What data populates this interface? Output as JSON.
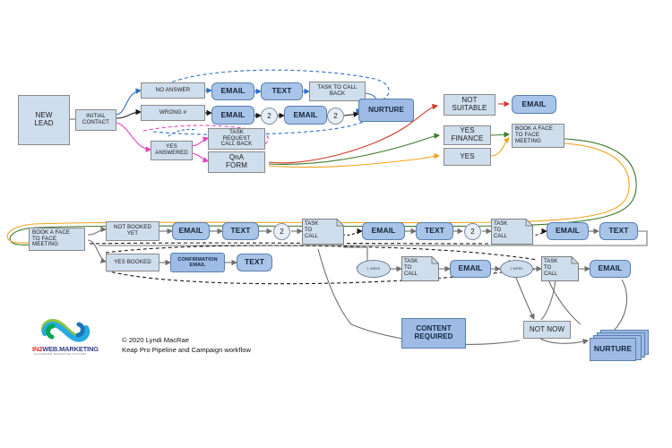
{
  "diagram": {
    "title": "Keap Pro Pipeline and Campaign workflow",
    "colors": {
      "pale_box_fill": "#cfdeec",
      "blue_box_fill": "#a8c4e8",
      "box_stroke": "#8a8a8a",
      "edge_blue": "#2f6fc4",
      "edge_black": "#1a1a1a",
      "edge_magenta": "#e83fc0",
      "edge_red": "#d03a2a",
      "edge_green": "#3f7a2b",
      "edge_orange": "#f0a41e",
      "edge_gray": "#6f6f6f"
    },
    "row1": {
      "new_lead": "NEW\nLEAD",
      "initial_contact": "INITIAL\nCONTACT",
      "no_answer": "NO ANSWER",
      "wrong_number": "WRONG #",
      "yes_answered": "YES\nANSWERED",
      "email_a": "EMAIL",
      "text_a": "TEXT",
      "task_to_call_back": "TASK TO CALL\nBACK",
      "email_b": "EMAIL",
      "counter_b1": "2",
      "email_c": "EMAIL",
      "counter_b2": "2",
      "nurture": "NURTURE",
      "task_request_call_back": "TASK\nREQUEST\nCALL BACK",
      "qna_form": "QnA\nFORM",
      "not_suitable": "NOT\nSUITABLE",
      "email_not_suitable": "EMAIL",
      "yes_finance": "YES\nFINANCE",
      "yes": "YES",
      "book_face_to_face": "BOOK A FACE\nTO FACE\nMEETING"
    },
    "row2": {
      "book_face_to_face": "BOOK A FACE\nTO FACE\nMEETING",
      "not_booked_yet": "NOT BOOKED\nYET",
      "yes_booked": "YES BOOKED",
      "email_1": "EMAIL",
      "text_1": "TEXT",
      "counter_1": "2",
      "task_to_call_1": "TASK\nTO\nCALL",
      "email_2": "EMAIL",
      "text_2": "TEXT",
      "counter_2": "2",
      "task_to_call_2": "TASK\nTO\nCALL",
      "email_3": "EMAIL",
      "text_3": "TEXT",
      "confirmation_email": "CONFIRMATION\nEMAIL",
      "text_confirm": "TEXT",
      "wait_1": "1\nWEEK",
      "task_to_call_3": "TASK\nTO\nCALL",
      "email_4": "EMAIL",
      "wait_2": "1\nWEEK",
      "task_to_call_4": "TASK\nTO\nCALL",
      "email_5": "EMAIL"
    },
    "row3": {
      "content_required": "CONTENT\nREQUIRED",
      "not_now": "NOT NOW",
      "nurture": "NURTURE"
    },
    "footer": {
      "logo_word_part1": "IN2",
      "logo_word_part2": "WEB.",
      "logo_word_part3": "MARKETING",
      "logo_tagline": "AUTOMATED MARKETING SYSTEMS",
      "copyright": "© 2020 Lyndi MacRae",
      "subtitle": "Keap Pro Pipeline and Campaign workflow"
    }
  }
}
